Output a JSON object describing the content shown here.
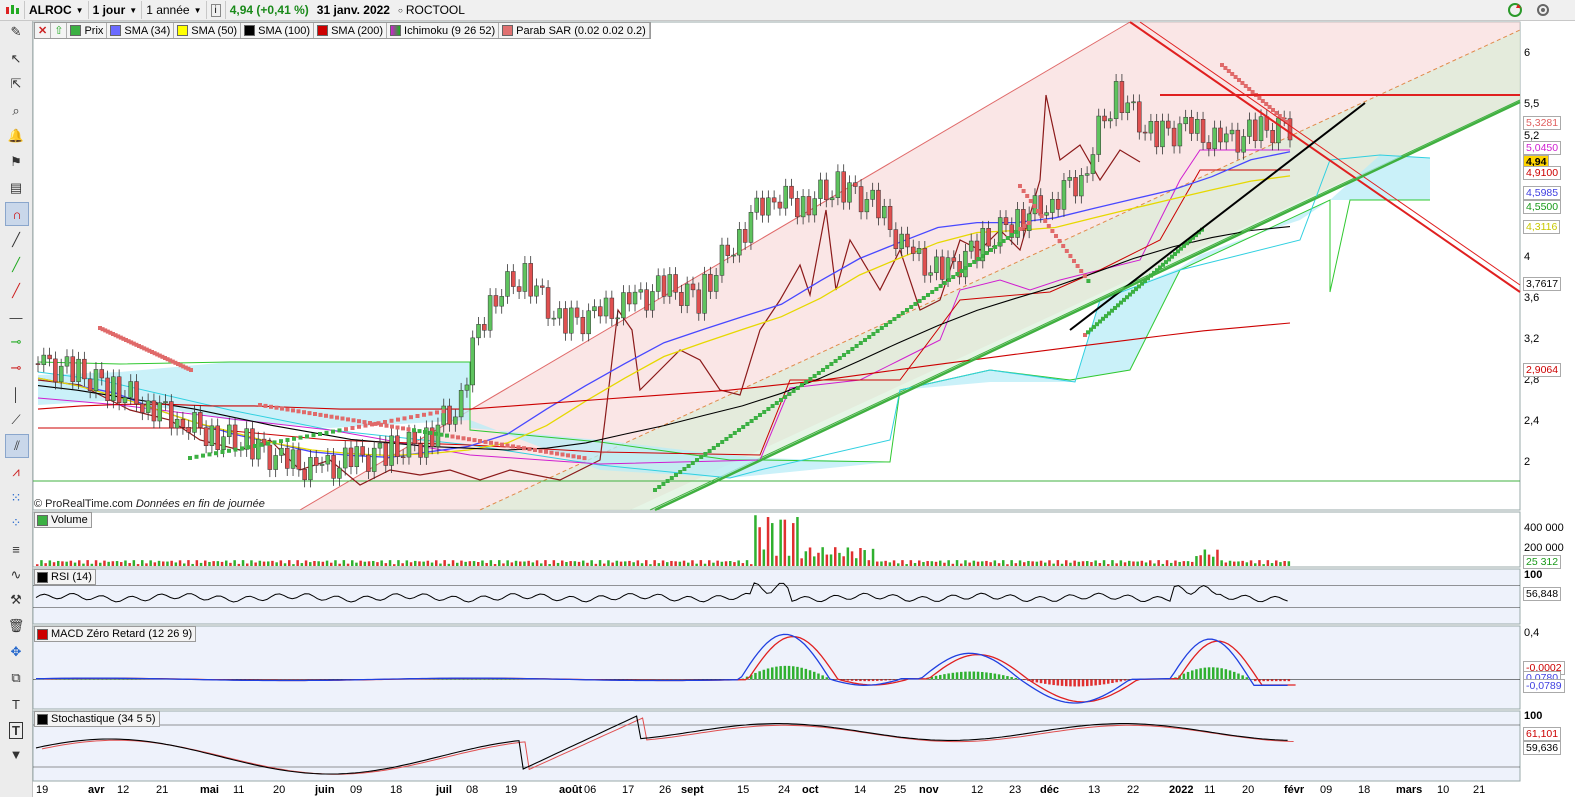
{
  "toolbar": {
    "symbol": "ALROC",
    "interval": "1 jour",
    "period": "1 année",
    "info": "i",
    "quote": "4,94 (+0,41 %)",
    "date": "31 janv. 2022",
    "name": "ROCTOOL"
  },
  "indicators": [
    {
      "label": "Prix",
      "color": "#3cb043"
    },
    {
      "label": "SMA (34)",
      "color": "#6a6aff"
    },
    {
      "label": "SMA (50)",
      "color": "#ffff00"
    },
    {
      "label": "SMA (100)",
      "color": "#000000"
    },
    {
      "label": "SMA (200)",
      "color": "#cc0000"
    },
    {
      "label": "Ichimoku (9 26 52)",
      "color": "#d01fd0"
    },
    {
      "label": "Parab SAR (0.02 0.02 0.2)",
      "color": "#e07070"
    }
  ],
  "copyright": {
    "brand": "© ProRealTime.com",
    "note": "Données en fin de journée"
  },
  "price_axis": {
    "ticks": [
      "6",
      "5,5",
      "5,2",
      "4",
      "3,6",
      "3,2",
      "2,8",
      "2,4",
      "2"
    ],
    "tags": [
      {
        "text": "5,3281",
        "color": "#e06060",
        "bg": "#ffffff"
      },
      {
        "text": "5,0450",
        "color": "#d01fd0",
        "bg": "#ffffff"
      },
      {
        "text": "4,94",
        "color": "#000000",
        "bg": "#ffd400"
      },
      {
        "text": "4,9100",
        "color": "#cc0000",
        "bg": "#ffffff"
      },
      {
        "text": "4,5985",
        "color": "#4040e0",
        "bg": "#ffffff"
      },
      {
        "text": "4,5500",
        "color": "#1a9a1a",
        "bg": "#ffffff"
      },
      {
        "text": "4,3116",
        "color": "#c8c800",
        "bg": "#ffffff"
      },
      {
        "text": "3,7617",
        "color": "#000000",
        "bg": "#ffffff"
      },
      {
        "text": "2,9064",
        "color": "#cc0000",
        "bg": "#ffffff"
      }
    ]
  },
  "panels": {
    "volume": {
      "label": "Volume",
      "color": "#3cb043",
      "ticks": [
        "400 000",
        "200 000"
      ],
      "last": "25 312"
    },
    "rsi": {
      "label": "RSI (14)",
      "color": "#000000",
      "top": "100",
      "last": "56,848"
    },
    "macd": {
      "label": "MACD Zéro Retard (12 26 9)",
      "color": "#cc0000",
      "top": "0,4",
      "last_signal": "-0,0002",
      "last_macd": "-0,0789",
      "mid": "0,0780"
    },
    "stoch": {
      "label": "Stochastique (34 5 5)",
      "color": "#000000",
      "top": "100",
      "last_k": "61,101",
      "last_d": "59,636"
    }
  },
  "x_axis": {
    "labels": [
      {
        "t": "19",
        "b": false
      },
      {
        "t": "avr",
        "b": true
      },
      {
        "t": "12",
        "b": false
      },
      {
        "t": "21",
        "b": false
      },
      {
        "t": "mai",
        "b": true
      },
      {
        "t": "11",
        "b": false
      },
      {
        "t": "20",
        "b": false
      },
      {
        "t": "juin",
        "b": true
      },
      {
        "t": "09",
        "b": false
      },
      {
        "t": "18",
        "b": false
      },
      {
        "t": "juil",
        "b": true
      },
      {
        "t": "08",
        "b": false
      },
      {
        "t": "19",
        "b": false
      },
      {
        "t": "août",
        "b": true
      },
      {
        "t": "06",
        "b": false
      },
      {
        "t": "17",
        "b": false
      },
      {
        "t": "26",
        "b": false
      },
      {
        "t": "sept",
        "b": true
      },
      {
        "t": "15",
        "b": false
      },
      {
        "t": "24",
        "b": false
      },
      {
        "t": "oct",
        "b": true
      },
      {
        "t": "14",
        "b": false
      },
      {
        "t": "25",
        "b": false
      },
      {
        "t": "nov",
        "b": true
      },
      {
        "t": "12",
        "b": false
      },
      {
        "t": "23",
        "b": false
      },
      {
        "t": "déc",
        "b": true
      },
      {
        "t": "13",
        "b": false
      },
      {
        "t": "22",
        "b": false
      },
      {
        "t": "2022",
        "b": true
      },
      {
        "t": "11",
        "b": false
      },
      {
        "t": "20",
        "b": false
      },
      {
        "t": "févr",
        "b": true
      },
      {
        "t": "09",
        "b": false
      },
      {
        "t": "18",
        "b": false
      },
      {
        "t": "mars",
        "b": true
      },
      {
        "t": "10",
        "b": false
      },
      {
        "t": "21",
        "b": false
      }
    ]
  },
  "chart_data": {
    "type": "line",
    "title": "",
    "ylim": [
      1.8,
      6.2
    ],
    "ylog": true,
    "x_range": [
      "2021-03-19",
      "2022-03-21"
    ],
    "series": [
      {
        "name": "Prix",
        "values": [
          2.6,
          2.55,
          2.45,
          2.35,
          2.25,
          2.15,
          2.1,
          2.0,
          1.95,
          2.0,
          2.05,
          2.1,
          2.3,
          3.1,
          3.3,
          2.9,
          2.95,
          3.05,
          3.2,
          3.1,
          3.6,
          4.1,
          4.0,
          4.2,
          4.0,
          3.5,
          3.3,
          3.55,
          3.8,
          4.0,
          4.3,
          5.4,
          4.8,
          4.9,
          4.7,
          4.85,
          4.94
        ]
      },
      {
        "name": "SMA (34)",
        "values": [
          2.5,
          2.45,
          2.4,
          2.3,
          2.22,
          2.15,
          2.1,
          2.05,
          2.03,
          2.02,
          2.05,
          2.08,
          2.15,
          2.3,
          2.45,
          2.6,
          2.75,
          2.85,
          2.95,
          3.05,
          3.25,
          3.45,
          3.6,
          3.75,
          3.8,
          3.8,
          3.85,
          3.95,
          4.05,
          4.15,
          4.3,
          4.5,
          4.6
        ]
      },
      {
        "name": "SMA (50)",
        "values": [
          2.5,
          2.45,
          2.38,
          2.3,
          2.22,
          2.16,
          2.1,
          2.06,
          2.04,
          2.03,
          2.04,
          2.06,
          2.1,
          2.2,
          2.35,
          2.5,
          2.65,
          2.75,
          2.85,
          2.95,
          3.1,
          3.3,
          3.45,
          3.6,
          3.7,
          3.72,
          3.75,
          3.85,
          3.95,
          4.05,
          4.15,
          4.25,
          4.31
        ]
      },
      {
        "name": "SMA (100)",
        "values": [
          2.45,
          2.42,
          2.38,
          2.34,
          2.3,
          2.25,
          2.2,
          2.16,
          2.12,
          2.1,
          2.08,
          2.07,
          2.06,
          2.07,
          2.1,
          2.15,
          2.2,
          2.26,
          2.32,
          2.4,
          2.5,
          2.62,
          2.75,
          2.88,
          3.0,
          3.1,
          3.2,
          3.32,
          3.45,
          3.56,
          3.65,
          3.72,
          3.76
        ]
      },
      {
        "name": "SMA (200)",
        "values": [
          2.3,
          2.32,
          2.33,
          2.33,
          2.32,
          2.32,
          2.31,
          2.3,
          2.3,
          2.3,
          2.3,
          2.32,
          2.34,
          2.36,
          2.38,
          2.4,
          2.42,
          2.45,
          2.48,
          2.52,
          2.56,
          2.6,
          2.64,
          2.68,
          2.72,
          2.76,
          2.8,
          2.84,
          2.87,
          2.9
        ]
      }
    ],
    "volume_max": 450000,
    "rsi_levels": [
      70,
      30
    ],
    "macd_range": [
      -0.25,
      0.45
    ],
    "stoch_levels": [
      80,
      20
    ]
  }
}
